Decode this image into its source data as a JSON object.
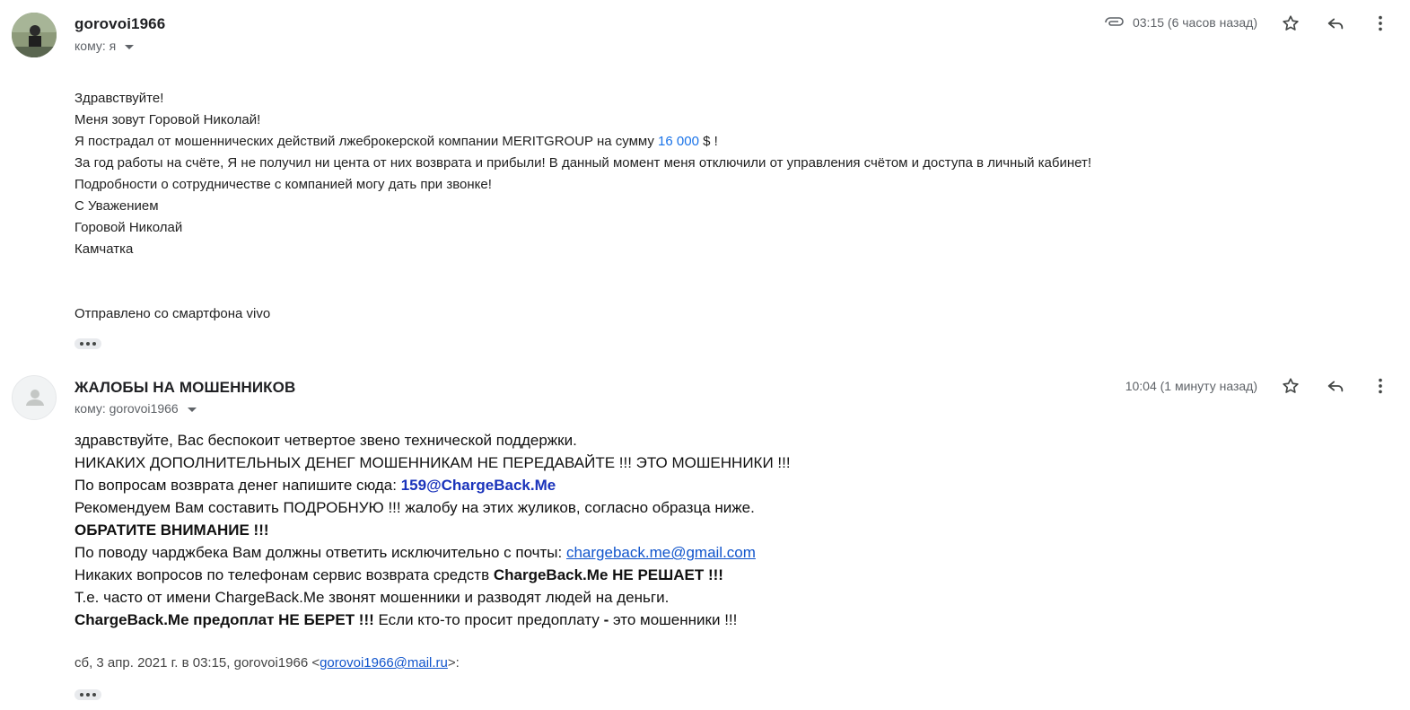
{
  "message1": {
    "sender": "gorovoi1966",
    "recipient_label": "кому: я",
    "time": "03:15 (6 часов назад)",
    "body": {
      "line1": "Здравствуйте!",
      "line2": "Меня зовут Горовой Николай!",
      "line3_pre": "Я пострадал от мошеннических действий лжеброкерской компании MERITGROUP на сумму ",
      "line3_amount": "16 000",
      "line3_post": " $ !",
      "line4": "За год работы на счёте, Я не получил ни цента от них возврата и прибыли! В данный момент меня отключили от управления счётом и доступа в личный кабинет!",
      "line5": "Подробности о сотрудничестве с компанией могу дать при звонке!",
      "line6": "С Уважением",
      "line7": "Горовой Николай",
      "line8": "Камчатка",
      "sent_from": "Отправлено со смартфона vivo"
    }
  },
  "message2": {
    "sender": "ЖАЛОБЫ НА МОШЕННИКОВ",
    "recipient_label": "кому: gorovoi1966",
    "time": "10:04 (1 минуту назад)",
    "body": {
      "line1": "здравствуйте, Вас беспокоит четвертое звено технической поддержки.",
      "line2": "НИКАКИХ ДОПОЛНИТЕЛЬНЫХ ДЕНЕГ МОШЕННИКАМ НЕ ПЕРЕДАВАЙТЕ !!! ЭТО МОШЕННИКИ !!!",
      "line3_pre": "По вопросам возврата денег напишите сюда: ",
      "line3_email": "159@ChargeBack.Me",
      "line4": "Рекомендуем Вам составить ПОДРОБНУЮ !!! жалобу на этих жуликов, согласно образца ниже.",
      "line5": "ОБРАТИТЕ ВНИМАНИЕ !!!",
      "line6_pre": "По поводу чарджбека Вам должны ответить исключительно с почты: ",
      "line6_email": "chargeback.me@gmail.com",
      "line7_pre": "Никаких вопросов по телефонам сервис возврата средств ",
      "line7_bold": "ChargeBack.Me НЕ РЕШАЕТ !!!",
      "line8": "Т.е. часто от имени ChargeBack.Me звонят мошенники и разводят людей на деньги.",
      "line9_bold": "ChargeBack.Me предоплат НЕ БЕРЕТ !!!",
      "line9_post": " Если кто-то просит предоплату ",
      "line9_dash": "-",
      "line9_end": " это мошенники !!!"
    },
    "quote": {
      "pre": "сб, 3 апр. 2021 г. в 03:15, gorovoi1966 <",
      "email": "gorovoi1966@mail.ru",
      "post": ">:"
    }
  },
  "icons": [
    "attachment-icon",
    "star-icon",
    "reply-icon",
    "more-vert-icon",
    "avatar-default-icon",
    "caret-down-icon"
  ],
  "colors": {
    "link": "#1155cc",
    "amount": "#1a73e8",
    "meta_gray": "#5f6368"
  }
}
